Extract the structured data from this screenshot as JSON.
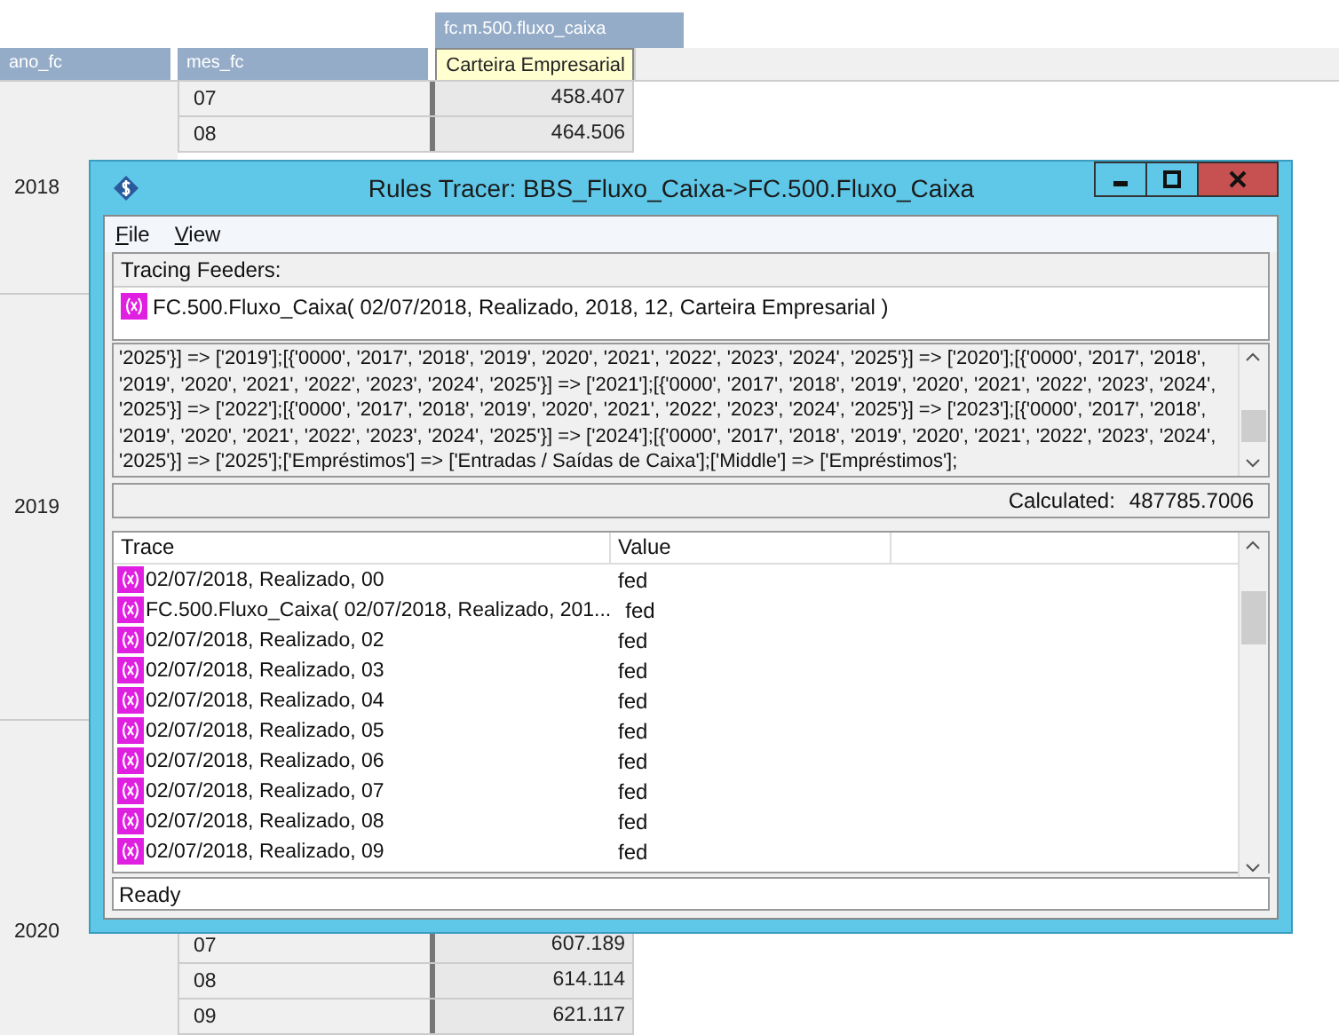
{
  "sheet": {
    "title_header": "fc.m.500.fluxo_caixa",
    "columns": [
      "ano_fc",
      "mes_fc",
      "Carteira Empresarial"
    ],
    "years": [
      "2018",
      "2019",
      "2020"
    ],
    "top_rows": [
      {
        "month": "07",
        "value": "458.407"
      },
      {
        "month": "08",
        "value": "464.506"
      }
    ],
    "bottom_rows": [
      {
        "month": "07",
        "value": "607.189"
      },
      {
        "month": "08",
        "value": "614.114"
      },
      {
        "month": "09",
        "value": "621.117"
      }
    ]
  },
  "dialog": {
    "title": "Rules Tracer: BBS_Fluxo_Caixa->FC.500.Fluxo_Caixa",
    "menu": [
      "File",
      "View"
    ],
    "feeders_label": "Tracing Feeders:",
    "feeder": "FC.500.Fluxo_Caixa( 02/07/2018, Realizado, 2018, 12, Carteira Empresarial )",
    "rule_text": "'2025'}] => ['2019'];[{'0000', '2017', '2018', '2019', '2020', '2021', '2022', '2023', '2024', '2025'}] => ['2020'];[{'0000', '2017', '2018', '2019', '2020', '2021', '2022', '2023', '2024', '2025'}] => ['2021'];[{'0000', '2017', '2018', '2019', '2020', '2021', '2022', '2023', '2024', '2025'}] => ['2022'];[{'0000', '2017', '2018', '2019', '2020', '2021', '2022', '2023', '2024', '2025'}] => ['2023'];[{'0000', '2017', '2018', '2019', '2020', '2021', '2022', '2023', '2024', '2025'}] => ['2024'];[{'0000', '2017', '2018', '2019', '2020', '2021', '2022', '2023', '2024', '2025'}] => ['2025'];['Empréstimos'] => ['Entradas / Saídas de Caixa'];['Middle'] => ['Empréstimos'];",
    "calculated_label": "Calculated:",
    "calculated_value": "487785.7006",
    "trace_columns": [
      "Trace",
      "Value"
    ],
    "trace_rows": [
      {
        "trace": "02/07/2018, Realizado, 00",
        "value": "fed"
      },
      {
        "trace": "FC.500.Fluxo_Caixa( 02/07/2018, Realizado, 201...",
        "value": "fed"
      },
      {
        "trace": "02/07/2018, Realizado, 02",
        "value": "fed"
      },
      {
        "trace": "02/07/2018, Realizado, 03",
        "value": "fed"
      },
      {
        "trace": "02/07/2018, Realizado, 04",
        "value": "fed"
      },
      {
        "trace": "02/07/2018, Realizado, 05",
        "value": "fed"
      },
      {
        "trace": "02/07/2018, Realizado, 06",
        "value": "fed"
      },
      {
        "trace": "02/07/2018, Realizado, 07",
        "value": "fed"
      },
      {
        "trace": "02/07/2018, Realizado, 08",
        "value": "fed"
      },
      {
        "trace": "02/07/2018, Realizado, 09",
        "value": "fed"
      }
    ],
    "status": "Ready"
  }
}
